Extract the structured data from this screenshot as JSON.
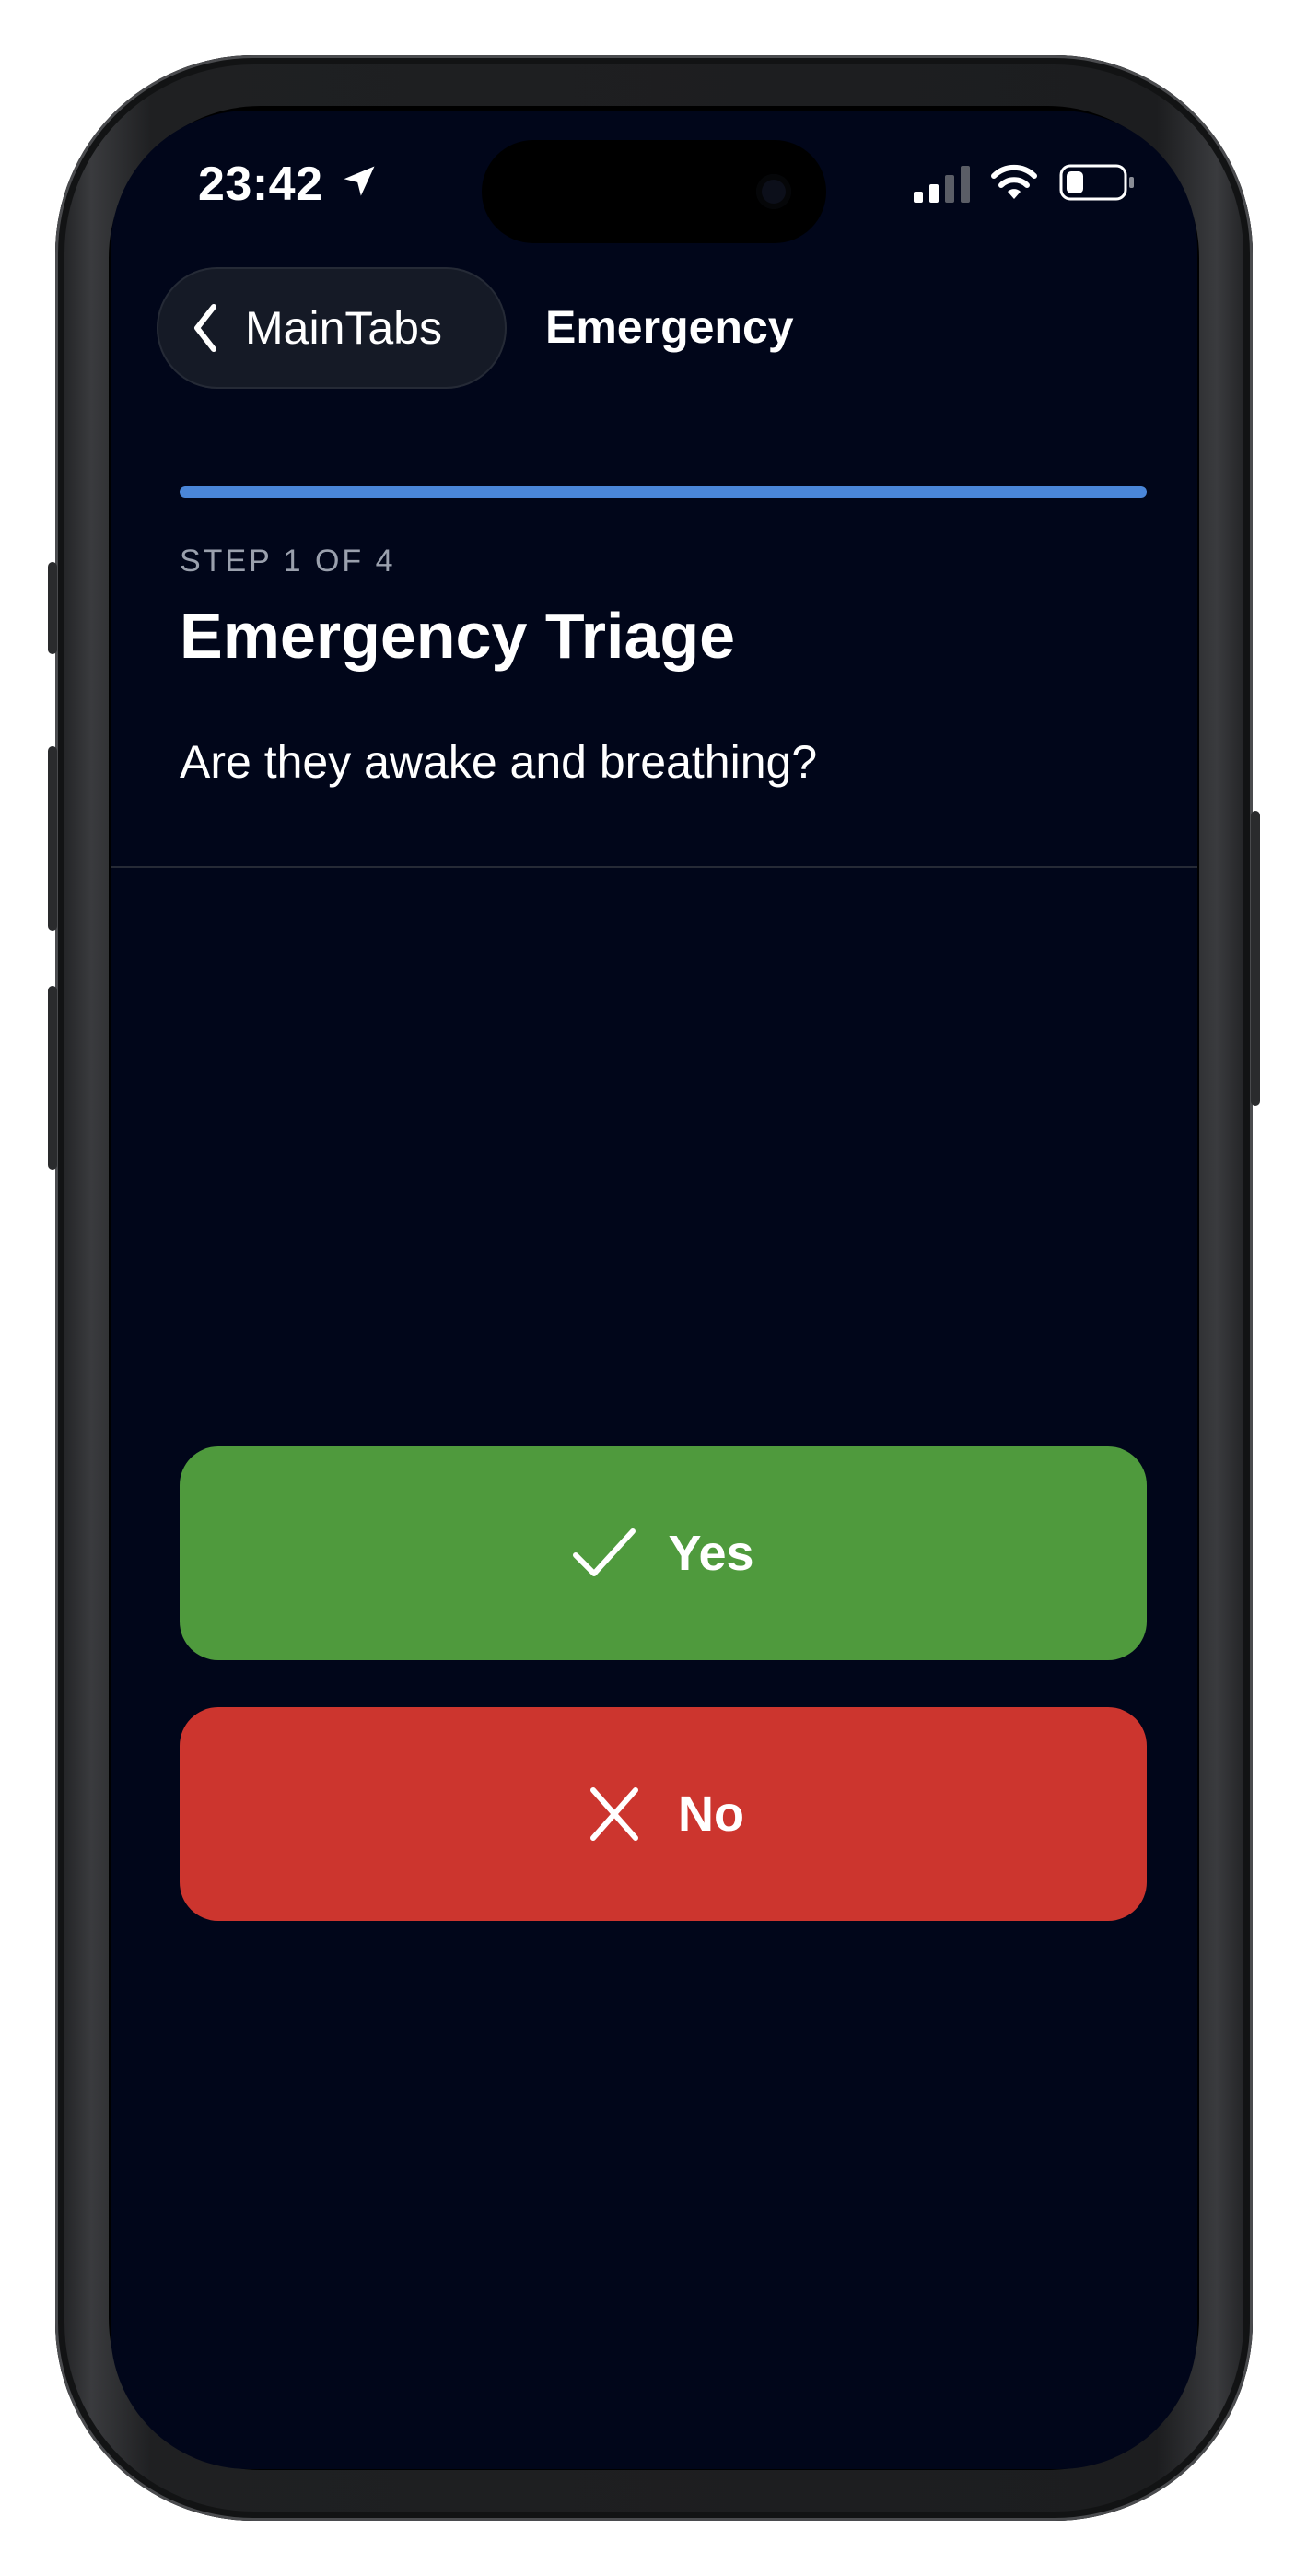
{
  "status_bar": {
    "time": "23:42",
    "icons": [
      "location-arrow-icon",
      "signal-icon",
      "wifi-icon",
      "battery-icon"
    ]
  },
  "nav": {
    "back_label": "MainTabs",
    "title": "Emergency"
  },
  "progress": {
    "current_step": 1,
    "total_steps": 4,
    "fill_fraction": 1.0,
    "color": "#4a86d9"
  },
  "content": {
    "step_label": "STEP 1 OF 4",
    "title": "Emergency Triage",
    "question": "Are they awake and breathing?"
  },
  "answers": {
    "yes": {
      "label": "Yes",
      "icon": "checkmark-icon",
      "color": "#4f9a3d"
    },
    "no": {
      "label": "No",
      "icon": "x-mark-icon",
      "color": "#cc352e"
    }
  },
  "colors": {
    "background": "#01061a",
    "text": "#ffffff",
    "secondary_text": "#9aa0ad"
  }
}
